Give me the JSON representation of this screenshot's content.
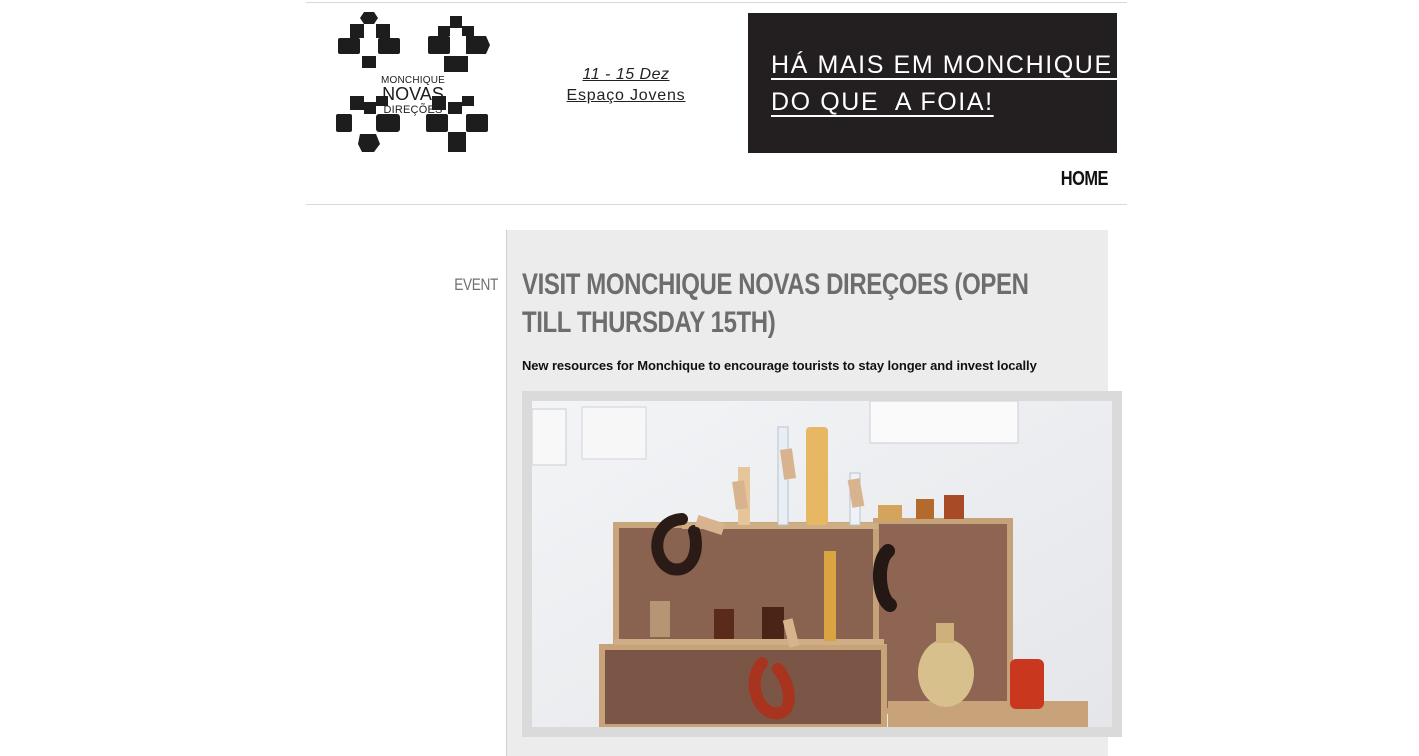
{
  "header": {
    "logo": {
      "line1": "MONCHIQUE",
      "line2": "NOVAS",
      "line3": "DIREÇÕES"
    },
    "dates": {
      "range": "11 - 15 Dez",
      "venue": "Espaço Jovens"
    },
    "banner": {
      "line1": "HÁ MAIS EM MONCHIQUE ",
      "line2": "DO QUE  A FOIA!"
    },
    "nav": {
      "home": "HOME"
    }
  },
  "post": {
    "category": "EVENT",
    "title": "VISIT MONCHIQUE NOVAS DIREÇOES (OPEN TILL THURSDAY 15TH)",
    "subtitle": "New resources for Monchique to encourage tourists to stay longer and invest locally"
  },
  "colors": {
    "banner_bg": "#231f20",
    "panel_bg": "#ececec",
    "title_gray": "#6d6d6d"
  }
}
